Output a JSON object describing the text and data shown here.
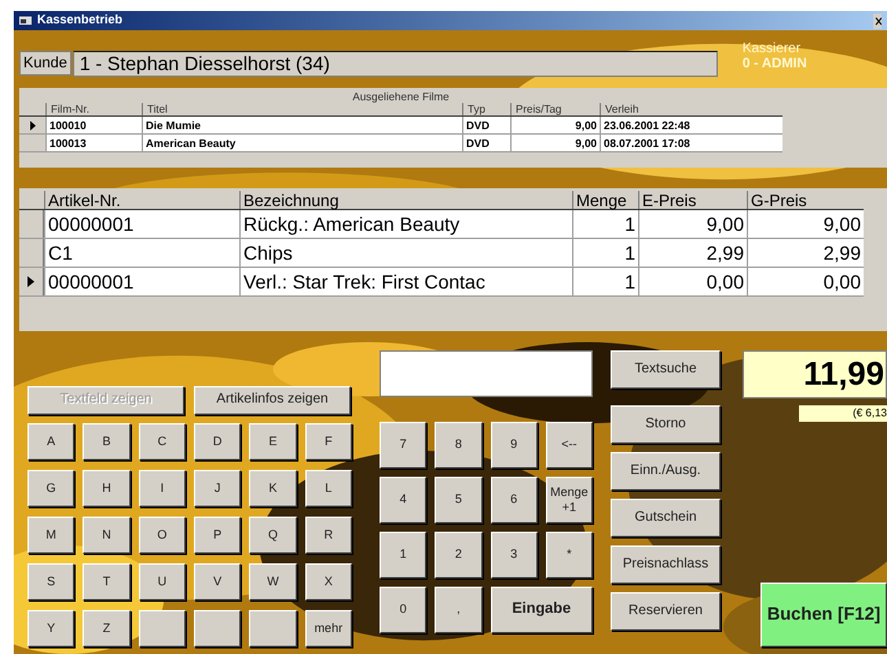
{
  "window": {
    "title": "Kassenbetrieb"
  },
  "customer": {
    "label": "Kunde",
    "value": "1 - Stephan Diesselhorst  (34)"
  },
  "cashier": {
    "label": "Kassierer",
    "value": "0 - ADMIN"
  },
  "rentals": {
    "title": "Ausgeliehene Filme",
    "columns": [
      "Film-Nr.",
      "Titel",
      "Typ",
      "Preis/Tag",
      "Verleih"
    ],
    "rows": [
      {
        "selected": true,
        "cells": [
          "100010",
          "Die Mumie",
          "DVD",
          "9,00",
          "23.06.2001 22:48"
        ]
      },
      {
        "selected": false,
        "cells": [
          "100013",
          "American Beauty",
          "DVD",
          "9,00",
          "08.07.2001 17:08"
        ]
      }
    ]
  },
  "items": {
    "columns": [
      "Artikel-Nr.",
      "Bezeichnung",
      "Menge",
      "E-Preis",
      "G-Preis"
    ],
    "rows": [
      {
        "selected": false,
        "cells": [
          "00000001",
          "Rückg.: American Beauty",
          "1",
          "9,00",
          "9,00"
        ]
      },
      {
        "selected": false,
        "cells": [
          "C1",
          "Chips",
          "1",
          "2,99",
          "2,99"
        ]
      },
      {
        "selected": true,
        "cells": [
          "00000001",
          "Verl.: Star Trek: First Contac",
          "1",
          "0,00",
          "0,00"
        ]
      }
    ]
  },
  "toggles": [
    {
      "label": "Textfeld zeigen",
      "disabled": true
    },
    {
      "label": "Artikelinfos zeigen",
      "disabled": false
    }
  ],
  "letters": [
    {
      "kind": "key",
      "label": "A"
    },
    {
      "kind": "key",
      "label": "B"
    },
    {
      "kind": "key",
      "label": "C"
    },
    {
      "kind": "key",
      "label": "D"
    },
    {
      "kind": "key",
      "label": "E"
    },
    {
      "kind": "key",
      "label": "F"
    },
    {
      "kind": "key",
      "label": "G"
    },
    {
      "kind": "key",
      "label": "H"
    },
    {
      "kind": "key",
      "label": "I"
    },
    {
      "kind": "key",
      "label": "J"
    },
    {
      "kind": "key",
      "label": "K"
    },
    {
      "kind": "key",
      "label": "L"
    },
    {
      "kind": "key",
      "label": "M"
    },
    {
      "kind": "key",
      "label": "N"
    },
    {
      "kind": "key",
      "label": "O"
    },
    {
      "kind": "key",
      "label": "P"
    },
    {
      "kind": "key",
      "label": "Q"
    },
    {
      "kind": "key",
      "label": "R"
    },
    {
      "kind": "key",
      "label": "S"
    },
    {
      "kind": "key",
      "label": "T"
    },
    {
      "kind": "key",
      "label": "U"
    },
    {
      "kind": "key",
      "label": "V"
    },
    {
      "kind": "key",
      "label": "W"
    },
    {
      "kind": "key",
      "label": "X"
    },
    {
      "kind": "key",
      "label": "Y"
    },
    {
      "kind": "key",
      "label": "Z"
    },
    {
      "kind": "blank"
    },
    {
      "kind": "blank"
    },
    {
      "kind": "blank"
    },
    {
      "kind": "key",
      "label": "mehr"
    }
  ],
  "numpad": [
    {
      "kind": "key",
      "label": "7"
    },
    {
      "kind": "key",
      "label": "8"
    },
    {
      "kind": "key",
      "label": "9"
    },
    {
      "kind": "key",
      "label": "<--"
    },
    {
      "kind": "key",
      "label": "4"
    },
    {
      "kind": "key",
      "label": "5"
    },
    {
      "kind": "key",
      "label": "6"
    },
    {
      "kind": "key",
      "label": "Menge +1"
    },
    {
      "kind": "key",
      "label": "1"
    },
    {
      "kind": "key",
      "label": "2"
    },
    {
      "kind": "key",
      "label": "3"
    },
    {
      "kind": "key",
      "label": "*"
    },
    {
      "kind": "key",
      "label": "0"
    },
    {
      "kind": "key",
      "label": ","
    },
    {
      "kind": "wide",
      "label": "Eingabe"
    }
  ],
  "actions": [
    "Textsuche",
    "Storno",
    "Einn./Ausg.",
    "Gutschein",
    "Preisnachlass",
    "Reservieren"
  ],
  "total": {
    "value": "11,99",
    "euro": "(€ 6,13"
  },
  "book_button": "Buchen [F12]"
}
